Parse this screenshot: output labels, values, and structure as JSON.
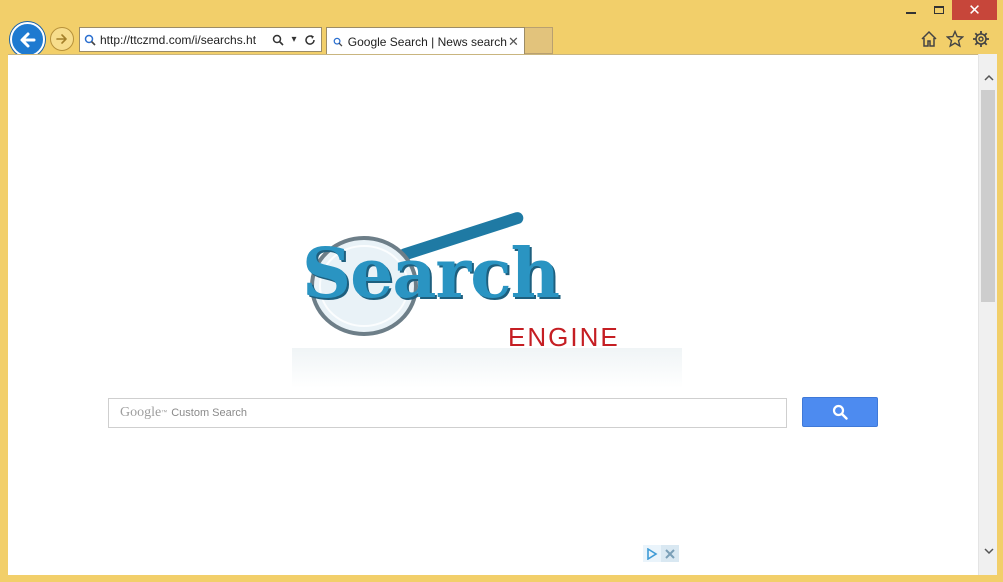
{
  "window": {
    "minimize_icon": "minimize-icon",
    "maximize_icon": "maximize-icon",
    "close_glyph": "✕"
  },
  "nav": {
    "address_url": "http://ttczmd.com/i/searchs.ht",
    "dropdown_glyph": "▾"
  },
  "tab": {
    "label": "Google Search | News search",
    "close_glyph": "✕"
  },
  "page": {
    "logo_word": "Search",
    "logo_sub": "ENGINE",
    "search_placeholder_brand": "Google",
    "search_placeholder_tm": "™",
    "search_placeholder_text": "Custom Search"
  },
  "colors": {
    "frame": "#f2cf6a",
    "accent_blue": "#1e7ad0",
    "search_button": "#4d8bf0",
    "logo_blue": "#2a94c2",
    "logo_red": "#c51e23"
  }
}
